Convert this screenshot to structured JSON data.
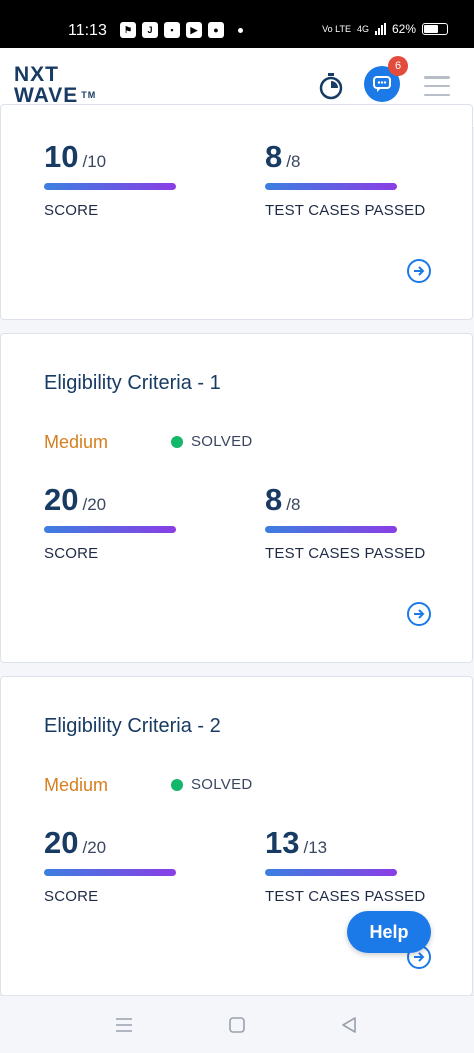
{
  "status_bar": {
    "time": "11:13",
    "network": "Vo LTE",
    "signal": "4G",
    "battery": "62%"
  },
  "header": {
    "logo_line1": "NXT",
    "logo_line2": "WAVE",
    "logo_tm": "TM",
    "chat_badge_count": "6"
  },
  "cards": [
    {
      "score": "10",
      "score_total": "/10",
      "tests": "8",
      "tests_total": "/8",
      "score_label": "SCORE",
      "tests_label": "TEST CASES PASSED"
    },
    {
      "title": "Eligibility Criteria - 1",
      "difficulty": "Medium",
      "status": "SOLVED",
      "score": "20",
      "score_total": "/20",
      "tests": "8",
      "tests_total": "/8",
      "score_label": "SCORE",
      "tests_label": "TEST CASES PASSED"
    },
    {
      "title": "Eligibility Criteria - 2",
      "difficulty": "Medium",
      "status": "SOLVED",
      "score": "20",
      "score_total": "/20",
      "tests": "13",
      "tests_total": "/13",
      "score_label": "SCORE",
      "tests_label": "TEST CASES PASSED"
    }
  ],
  "help_button": "Help",
  "colors": {
    "brand": "#183b63",
    "accent": "#1b7ae8",
    "medium": "#d57f1e",
    "solved": "#12b76a",
    "progress_start": "#3c7fe0",
    "progress_end": "#8a3ee5"
  }
}
